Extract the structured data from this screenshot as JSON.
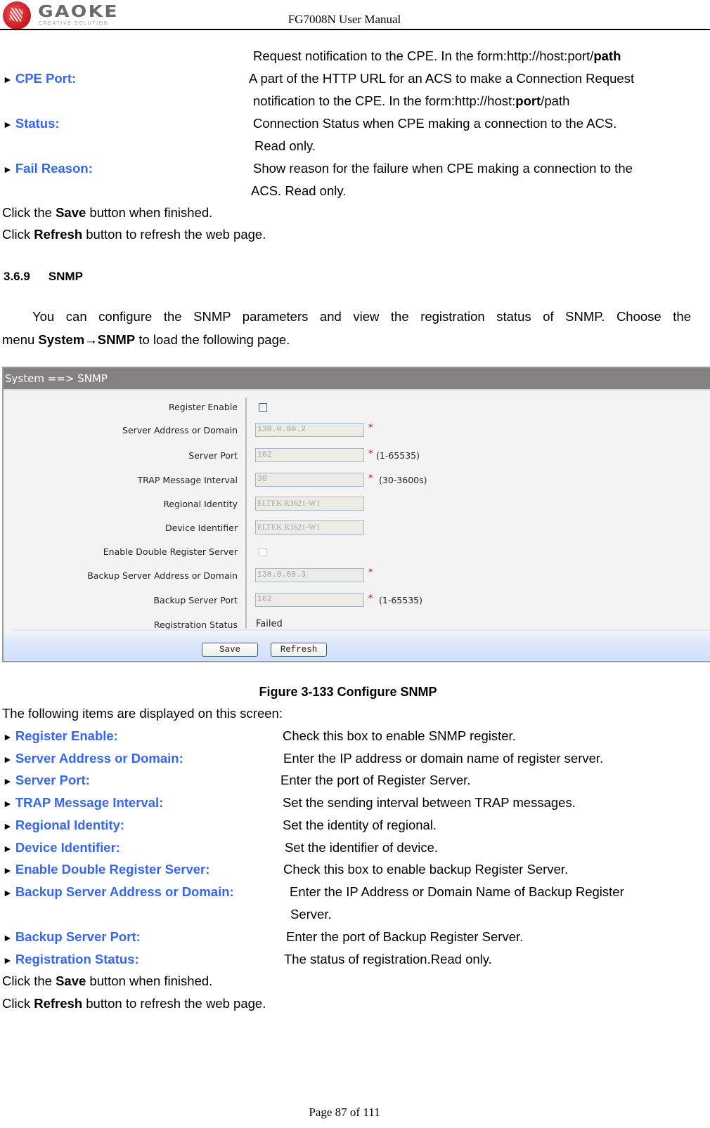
{
  "header": {
    "logo_word": "GAOKE",
    "logo_tagline": "CREATIVE SOLUTION",
    "doc_title": "FG7008N User Manual"
  },
  "continued": {
    "line1": "Request notification to the CPE. In the form:http://host:port/",
    "line1_bold": "path",
    "items": [
      {
        "label": "CPE Port:",
        "desc": "A part of the HTTP URL for an ACS to make a Connection Request",
        "desc2_pre": "notification to the CPE. In the form:http://host:",
        "desc2_bold": "port",
        "desc2_post": "/path"
      },
      {
        "label": "Status:",
        "desc": "Connection Status when CPE making a connection to the ACS.",
        "desc2": "Read only."
      },
      {
        "label": "Fail Reason:",
        "desc": "Show reason for the failure when CPE making a connection to the",
        "desc2": "ACS. Read only."
      }
    ],
    "save_pre": "Click the ",
    "save_bold": "Save",
    "save_post": " button when finished.",
    "refresh_pre": "Click ",
    "refresh_bold": "Refresh",
    "refresh_post": " button to refresh the web page."
  },
  "section": {
    "number": "3.6.9",
    "title": "SNMP",
    "intro1": "You can configure the SNMP parameters and view the registration status of SNMP. Choose the",
    "intro2_pre": "menu ",
    "intro2_bold": "System→SNMP",
    "intro2_post": " to load the following page."
  },
  "snmp_page": {
    "title": "System ==> SNMP",
    "fields": {
      "register_enable": {
        "label": "Register Enable",
        "checked": false
      },
      "server_address": {
        "label": "Server Address or Domain",
        "value": "138.0.60.2",
        "required": "*"
      },
      "server_port": {
        "label": "Server Port",
        "value": "162",
        "required": "*",
        "hint": "(1-65535)"
      },
      "trap_interval": {
        "label": "TRAP Message Interval",
        "value": "30",
        "required": "*",
        "hint": "(30-3600s)"
      },
      "regional_identity": {
        "label": "Regional Identity",
        "value": "ELTEK R3621-W1"
      },
      "device_identifier": {
        "label": "Device Identifier",
        "value": "ELTEK R3621-W1"
      },
      "double_register": {
        "label": "Enable Double Register Server",
        "checked": false
      },
      "backup_address": {
        "label": "Backup Server Address or Domain",
        "value": "138.0.60.3",
        "required": "*"
      },
      "backup_port": {
        "label": "Backup Server Port",
        "value": "162",
        "required": "*",
        "hint": "(1-65535)"
      },
      "registration_status": {
        "label": "Registration Status",
        "value": "Failed"
      }
    },
    "buttons": {
      "save": "Save",
      "refresh": "Refresh"
    }
  },
  "figure_caption": "Figure 3-133  Configure SNMP",
  "items_intro": "The following items are displayed on this screen:",
  "items": [
    {
      "label": "Register Enable:",
      "desc": "Check this box to enable SNMP register."
    },
    {
      "label": "Server Address or Domain:",
      "desc": "Enter the IP address or domain name of register server."
    },
    {
      "label": "Server Port:",
      "desc": "Enter the port of Register Server."
    },
    {
      "label": "TRAP Message Interval:",
      "desc": "Set the sending interval between TRAP messages."
    },
    {
      "label": "Regional Identity:",
      "desc": "Set the identity of regional."
    },
    {
      "label": "Device Identifier:",
      "desc": "Set the identifier of device."
    },
    {
      "label": "Enable Double Register Server:",
      "desc": "Check this box to enable backup Register Server."
    },
    {
      "label": "Backup Server Address or Domain:",
      "desc": "Enter the IP Address or Domain Name of Backup Register",
      "desc2": "Server."
    },
    {
      "label": "Backup Server Port:",
      "desc": "Enter the port of Backup Register Server."
    },
    {
      "label": "Registration Status:",
      "desc": "The status of registration.Read only."
    }
  ],
  "closing": {
    "save_pre": "Click the ",
    "save_bold": "Save",
    "save_post": " button when finished.",
    "refresh_pre": "Click ",
    "refresh_bold": "Refresh",
    "refresh_post": " button to refresh the web page."
  },
  "footer": {
    "page_label": "Page 87 of 111"
  },
  "icons": {
    "bullet": "►"
  }
}
